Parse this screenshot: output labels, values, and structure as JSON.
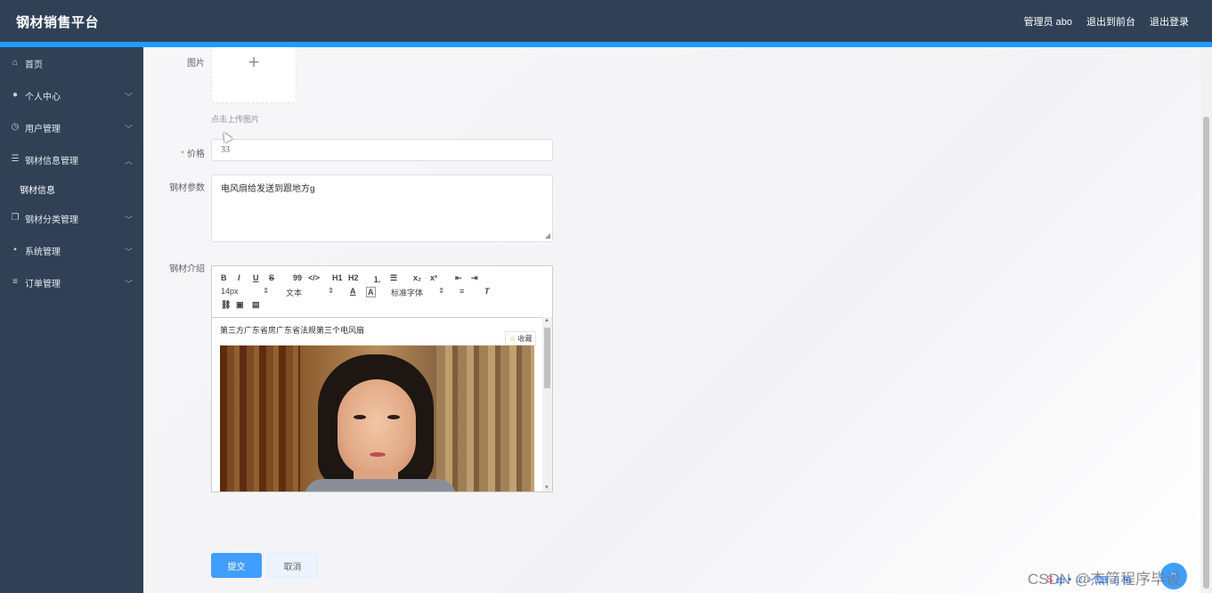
{
  "header": {
    "brand": "钢材销售平台",
    "user": "管理员 abo",
    "front_link": "退出到前台",
    "logout": "退出登录"
  },
  "sidebar": {
    "items": [
      {
        "label": "首页",
        "icon": "home-icon"
      },
      {
        "label": "个人中心",
        "icon": "user-icon"
      },
      {
        "label": "用户管理",
        "icon": "clock-icon"
      },
      {
        "label": "钢材信息管理",
        "icon": "sliders-icon"
      },
      {
        "label": "钢材分类管理",
        "icon": "copy-icon"
      },
      {
        "label": "系统管理",
        "icon": "message-icon"
      },
      {
        "label": "订单管理",
        "icon": "list-icon"
      }
    ],
    "subitem": "钢材信息"
  },
  "form": {
    "image_label": "图片",
    "upload_tip": "点击上传图片",
    "price_label": "价格",
    "price_value": "33",
    "params_label": "钢材参数",
    "params_value": "电风扇给发送到跟地方g",
    "intro_label": "钢材介绍",
    "submit": "提交",
    "cancel": "取消"
  },
  "editor": {
    "toolbar": {
      "bold": "B",
      "italic": "I",
      "underline": "U",
      "strike": "S",
      "quote": "99",
      "code": "</>",
      "h1": "H1",
      "h2": "H2",
      "sub": "x₂",
      "sup": "x²",
      "size": "14px",
      "style": "文本",
      "font": "标准字体"
    },
    "content_line": "第三方广东省房广东省法规第三个电风扇",
    "favorite": "收藏"
  },
  "overlay": {
    "watermark": "CSDN @杰简程序毕设",
    "ime": "中"
  }
}
